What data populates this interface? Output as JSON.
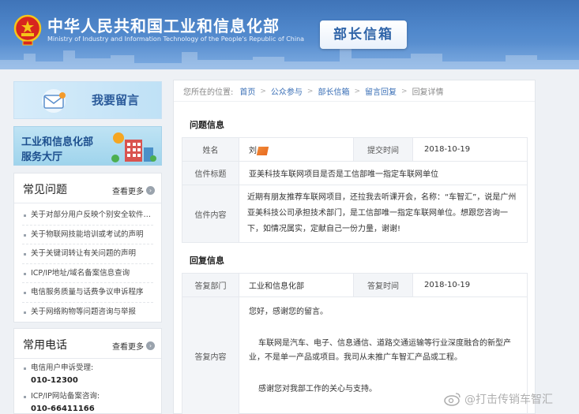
{
  "header": {
    "title": "中华人民共和国工业和信息化部",
    "subtitle": "Ministry of Industry and Information Technology of the People's Republic of China",
    "section_tab": "部长信箱"
  },
  "sidebar": {
    "leave_message_label": "我要留言",
    "service_hall_line1": "工业和信息化部",
    "service_hall_line2": "服务大厅",
    "faq": {
      "title": "常见问题",
      "more": "查看更多",
      "items": [
        "关于对部分用户反映个别安全软件存…",
        "关于物联网技能培训或考试的声明",
        "关于关键词转让有关问题的声明",
        "ICP/IP地址/域名备案信息查询",
        "电信服务质量与话费争议申诉程序",
        "关于网络购物等问题咨询与举报"
      ]
    },
    "phones": {
      "title": "常用电话",
      "more": "查看更多",
      "items": [
        {
          "label": "电信用户申诉受理:",
          "number": "010-12300"
        },
        {
          "label": "ICP/IP网站备案咨询:",
          "number": "010-66411166"
        }
      ]
    }
  },
  "breadcrumb": {
    "prefix": "您所在的位置:",
    "items": [
      "首页",
      "公众参与",
      "部长信箱",
      "留言回复"
    ],
    "current": "回复详情"
  },
  "question": {
    "section_title": "问题信息",
    "name_label": "姓名",
    "name_value": "刘",
    "time_label": "提交时间",
    "time_value": "2018-10-19",
    "subject_label": "信件标题",
    "subject_value": "亚美科技车联网项目是否是工信部唯一指定车联网单位",
    "content_label": "信件内容",
    "content_value": "近期有朋友推荐车联网项目，还拉我去听课开会，名称：“车智汇”，说是广州亚美科技公司承担技术部门，是工信部唯一指定车联网单位。想跟您咨询一下，如情况属实，定献自己一份力量，谢谢!"
  },
  "reply": {
    "section_title": "回复信息",
    "dept_label": "答复部门",
    "dept_value": "工业和信息化部",
    "time_label": "答复时间",
    "time_value": "2018-10-19",
    "content_label": "答复内容",
    "paragraphs": [
      "您好，感谢您的留言。",
      "车联网是汽车、电子、信息通信、道路交通运输等行业深度融合的新型产业，不是单一产品或项目。我司从未推广车智汇产品或工程。",
      "感谢您对我部工作的关心与支持。"
    ]
  },
  "watermark": "@打击传销车智汇",
  "colors": {
    "header_blue": "#4a80c4",
    "link_blue": "#3a6fb6",
    "redaction_orange": "#ee7a2c"
  }
}
